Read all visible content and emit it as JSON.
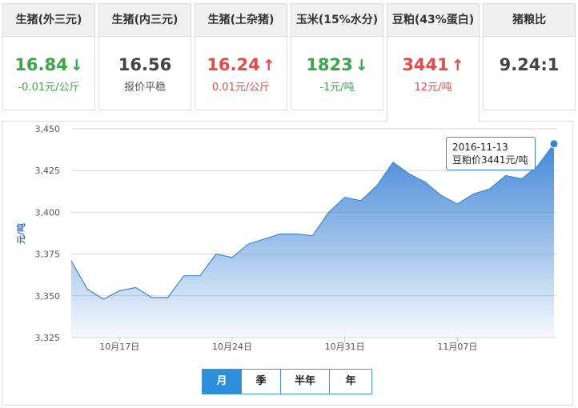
{
  "cards": [
    {
      "title": "生猪(外三元)",
      "price": "16.84",
      "direction": "down",
      "change": "-0.01元/公斤"
    },
    {
      "title": "生猪(内三元)",
      "price": "16.56",
      "direction": "flat",
      "change": "报价平稳"
    },
    {
      "title": "生猪(土杂猪)",
      "price": "16.24",
      "direction": "up",
      "change": "0.01元/公斤"
    },
    {
      "title": "玉米(15%水分)",
      "price": "1823",
      "direction": "down",
      "change": "-1元/吨"
    },
    {
      "title": "豆粕(43%蛋白)",
      "price": "3441",
      "direction": "up",
      "change": "12元/吨"
    },
    {
      "title": "猪粮比",
      "price": "9.24:1",
      "direction": "none",
      "change": ""
    }
  ],
  "icons": {
    "up": "arrow-up-icon",
    "down": "arrow-down-icon"
  },
  "colors": {
    "up": "#e84a4a",
    "down": "#3aa64a",
    "accent": "#2d8fdc",
    "series": "#3b88cf"
  },
  "range_buttons": [
    {
      "label": "月",
      "selected": true
    },
    {
      "label": "季",
      "selected": false
    },
    {
      "label": "半年",
      "selected": false
    },
    {
      "label": "年",
      "selected": false
    }
  ],
  "tooltip": {
    "date": "2016-11-13",
    "text": "豆粕价3441元/吨"
  },
  "chart_data": {
    "type": "area",
    "title": "",
    "xlabel": "",
    "ylabel": "元/吨",
    "ylim": [
      3325,
      3450
    ],
    "yticks": [
      3325,
      3350,
      3375,
      3400,
      3425,
      3450
    ],
    "yticklabels": [
      "3,325",
      "3,350",
      "3,375",
      "3,400",
      "3,425",
      "3,450"
    ],
    "xticks": [
      "2016-10-17",
      "2016-10-24",
      "2016-10-31",
      "2016-11-07"
    ],
    "xticklabels": [
      "10月17日",
      "10月24日",
      "10月31日",
      "11月07日"
    ],
    "grid": true,
    "legend": "none",
    "series": [
      {
        "name": "豆粕价",
        "x": [
          "2016-10-14",
          "2016-10-15",
          "2016-10-16",
          "2016-10-17",
          "2016-10-18",
          "2016-10-19",
          "2016-10-20",
          "2016-10-21",
          "2016-10-22",
          "2016-10-23",
          "2016-10-24",
          "2016-10-25",
          "2016-10-26",
          "2016-10-27",
          "2016-10-28",
          "2016-10-29",
          "2016-10-30",
          "2016-10-31",
          "2016-11-01",
          "2016-11-02",
          "2016-11-03",
          "2016-11-04",
          "2016-11-05",
          "2016-11-06",
          "2016-11-07",
          "2016-11-08",
          "2016-11-09",
          "2016-11-10",
          "2016-11-11",
          "2016-11-12",
          "2016-11-13"
        ],
        "values": [
          3371,
          3354,
          3348,
          3353,
          3355,
          3349,
          3349,
          3362,
          3362,
          3375,
          3373,
          3381,
          3384,
          3387,
          3387,
          3386,
          3400,
          3409,
          3407,
          3416,
          3430,
          3423,
          3418,
          3410,
          3405,
          3411,
          3414,
          3422,
          3420,
          3428,
          3441
        ]
      }
    ]
  }
}
